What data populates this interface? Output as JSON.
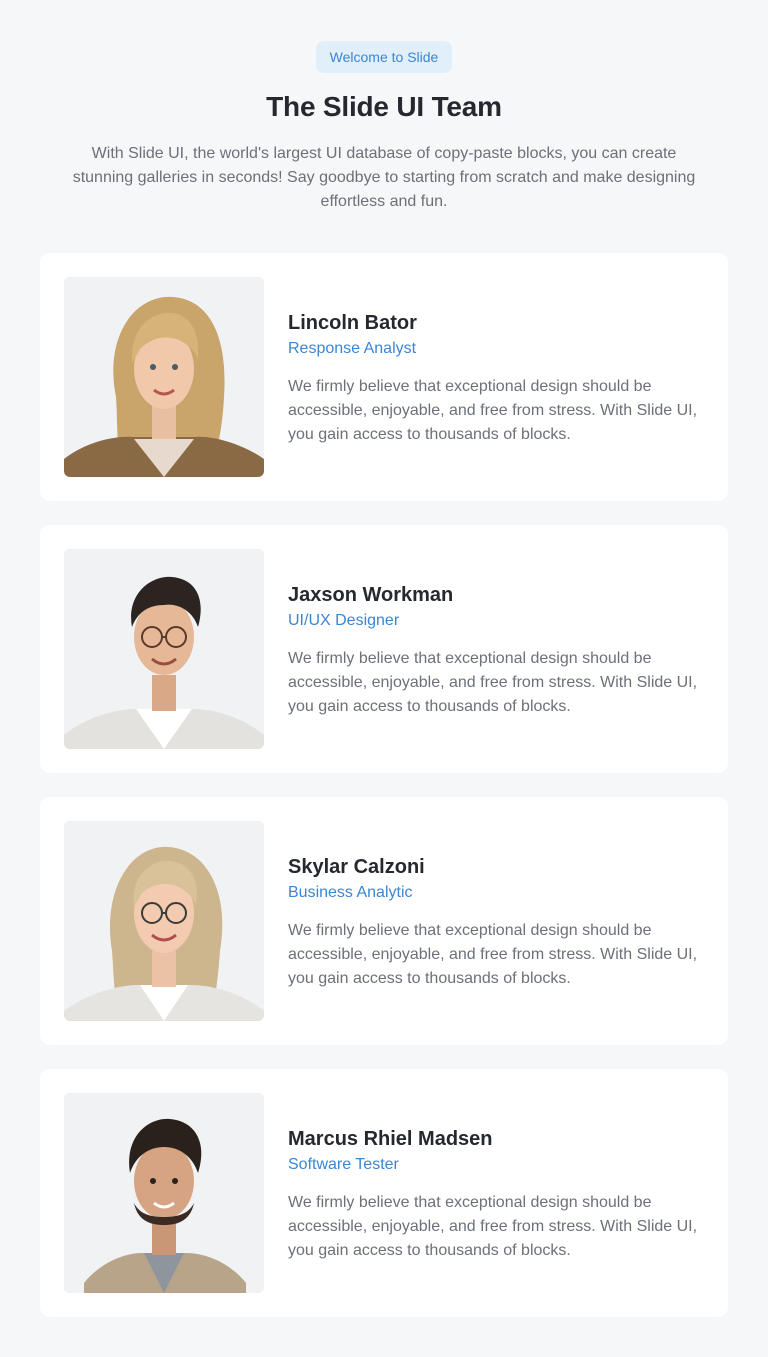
{
  "header": {
    "badge": "Welcome to Slide",
    "title": "The Slide UI Team",
    "intro": "With Slide UI, the world's largest UI database of copy-paste blocks, you can create stunning galleries in seconds! Say goodbye to starting from scratch and make designing effortless and fun."
  },
  "team": [
    {
      "name": "Lincoln Bator",
      "role": "Response Analyst",
      "bio": "We firmly believe that exceptional design should be accessible, enjoyable, and free from stress. With Slide UI, you gain access to thousands of blocks.",
      "photo_icon": "portrait-woman-blonde"
    },
    {
      "name": "Jaxson Workman",
      "role": "UI/UX Designer",
      "bio": "We firmly believe that exceptional design should be accessible, enjoyable, and free from stress. With Slide UI, you gain access to thousands of blocks.",
      "photo_icon": "portrait-man-glasses"
    },
    {
      "name": "Skylar Calzoni",
      "role": "Business Analytic",
      "bio": "We firmly believe that exceptional design should be accessible, enjoyable, and free from stress. With Slide UI, you gain access to thousands of blocks.",
      "photo_icon": "portrait-woman-glasses"
    },
    {
      "name": "Marcus Rhiel Madsen",
      "role": "Software Tester",
      "bio": "We firmly believe that exceptional design should be accessible, enjoyable, and free from stress. With Slide UI, you gain access to thousands of blocks.",
      "photo_icon": "portrait-man-beard"
    }
  ],
  "colors": {
    "background": "#f6f7f9",
    "card": "#ffffff",
    "accent": "#3a86d4",
    "badge_bg": "#e1effb",
    "heading": "#25292f",
    "body_text": "#6b7079"
  }
}
